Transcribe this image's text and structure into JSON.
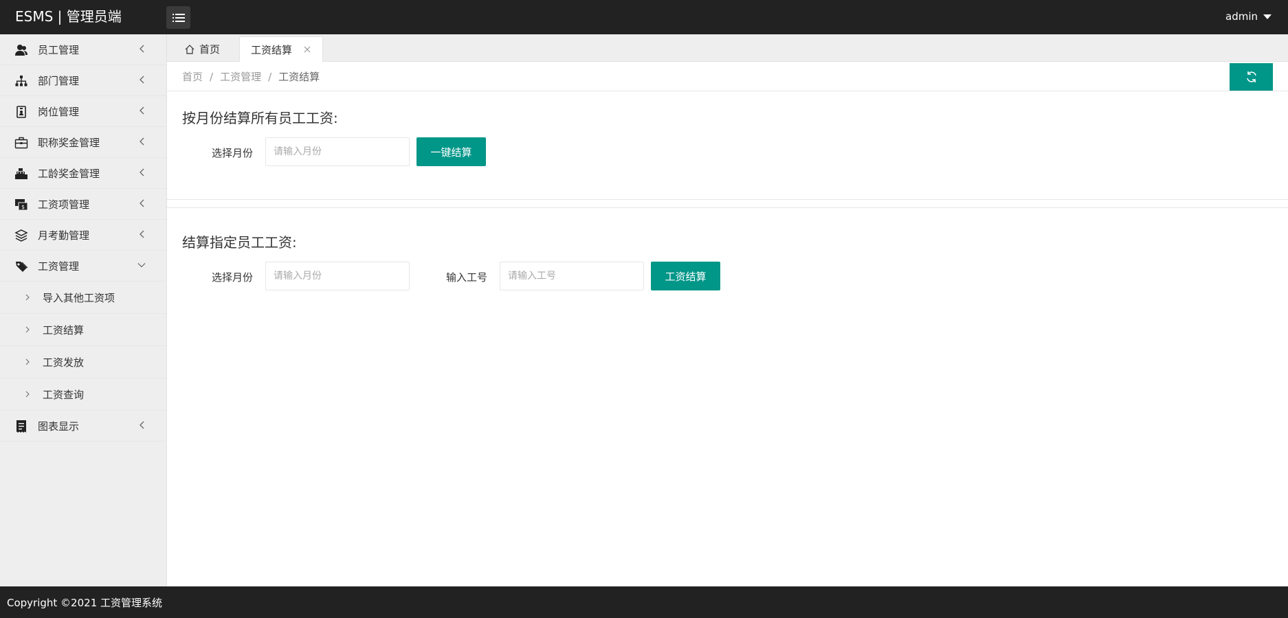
{
  "header": {
    "logo": "ESMS | 管理员端",
    "user": "admin"
  },
  "sidebar": {
    "items": [
      {
        "label": "员工管理",
        "icon": "users-icon"
      },
      {
        "label": "部门管理",
        "icon": "sitemap-icon"
      },
      {
        "label": "岗位管理",
        "icon": "badge-icon"
      },
      {
        "label": "职称奖金管理",
        "icon": "briefcase-icon"
      },
      {
        "label": "工龄奖金管理",
        "icon": "cash-register-icon"
      },
      {
        "label": "工资项管理",
        "icon": "money-chat-icon"
      },
      {
        "label": "月考勤管理",
        "icon": "layers-icon"
      },
      {
        "label": "工资管理",
        "icon": "tag-icon",
        "expanded": true,
        "children": [
          "导入其他工资项",
          "工资结算",
          "工资发放",
          "工资查询"
        ]
      },
      {
        "label": "图表显示",
        "icon": "receipt-icon"
      }
    ]
  },
  "tabs": {
    "home": "首页",
    "active": "工资结算"
  },
  "breadcrumb": [
    "首页",
    "工资管理",
    "工资结算"
  ],
  "section1": {
    "title": "按月份结算所有员工工资:",
    "month_label": "选择月份",
    "month_placeholder": "请输入月份",
    "button": "一键结算"
  },
  "section2": {
    "title": "结算指定员工工资:",
    "month_label": "选择月份",
    "month_placeholder": "请输入月份",
    "id_label": "输入工号",
    "id_placeholder": "请输入工号",
    "button": "工资结算"
  },
  "footer": "Copyright ©2021 工资管理系统",
  "colors": {
    "accent": "#009688",
    "header_bg": "#222222",
    "sidebar_bg": "#eeeeee"
  }
}
